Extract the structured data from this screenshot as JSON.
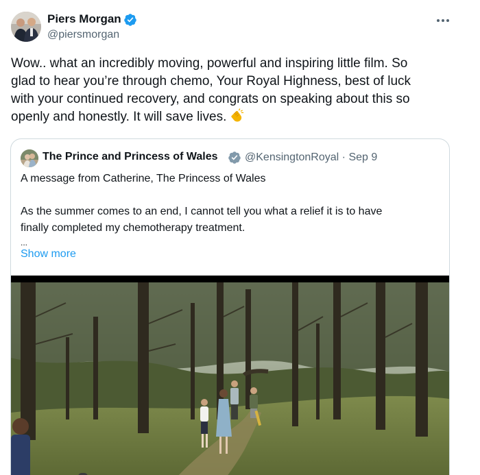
{
  "author": {
    "name": "Piers Morgan",
    "handle": "@piersmorgan",
    "verified_color": "#1d9bf0"
  },
  "tweet": {
    "text_lines": [
      "Wow.. what an incredibly moving, powerful and inspiring little film. So",
      "glad to hear you’re through chemo, Your Royal Highness, best of luck",
      "with your continued recovery, and congrats on speaking about this so",
      "openly and honestly. It will save lives."
    ],
    "emoji": "clapping-hands-icon"
  },
  "quote": {
    "name": "The Prince and Princess of Wales",
    "handle": "@KensingtonRoyal",
    "separator": "·",
    "date": "Sep 9",
    "badge_color": "#829aab",
    "text_lines": [
      "A message from Catherine, The Princess of Wales",
      "",
      "As the summer comes to an end, I cannot tell you what a relief it is to have",
      "finally completed my chemotherapy treatment.",
      "..."
    ],
    "show_more": "Show more"
  },
  "icons": {
    "more": "more-options-icon",
    "verified": "verified-badge-icon"
  }
}
